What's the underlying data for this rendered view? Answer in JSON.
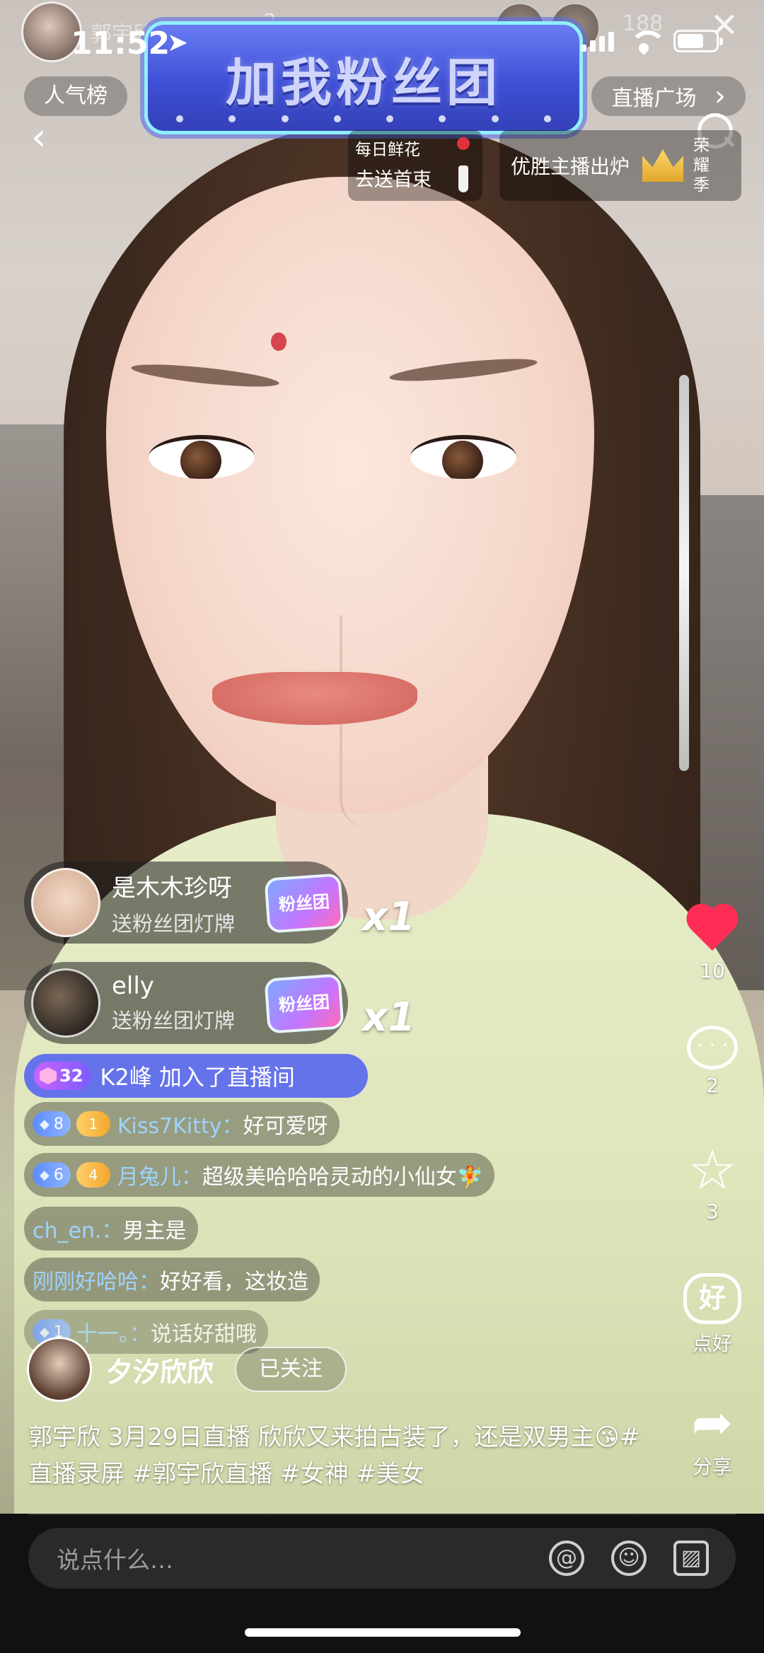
{
  "status_bar": {
    "time": "11:52"
  },
  "top": {
    "streamer_name": "郭宇欣",
    "viewer_count": "188",
    "badge_count": "2",
    "fan_banner": "加我粉丝团",
    "left_tab": "人气榜",
    "right_tab": "直播广场",
    "right_tab_chevron": "›"
  },
  "promos": {
    "flower_line1": "每日鲜花",
    "flower_line2": "去送首束",
    "winner": "优胜主播出炉",
    "season": "荣耀季"
  },
  "gifts": [
    {
      "name": "是木木珍呀",
      "action": "送粉丝团灯牌",
      "badge": "粉丝团",
      "count": "x1"
    },
    {
      "name": "elly",
      "action": "送粉丝团灯牌",
      "badge": "粉丝团",
      "count": "x1"
    }
  ],
  "join": {
    "level": "32",
    "text": "K2峰 加入了直播间"
  },
  "chat": [
    {
      "rank": "8",
      "heart": "1",
      "user": "Kiss7Kitty：",
      "msg": "好可爱呀"
    },
    {
      "rank": "6",
      "heart": "4",
      "user": "月兔儿：",
      "msg": "超级美哈哈哈灵动的小仙女🧚"
    },
    {
      "rank": "",
      "heart": "",
      "user": "ch_en.：",
      "msg": "男主是"
    },
    {
      "rank": "",
      "heart": "",
      "user": "刚刚好哈哈：",
      "msg": "好好看，这妆造"
    },
    {
      "rank": "1",
      "heart": "",
      "user": "十一。：",
      "msg": "说话好甜哦"
    }
  ],
  "rail": {
    "likes": "10",
    "comments": "2",
    "stars": "3",
    "good_label": "点好",
    "good_glyph": "好",
    "share_label": "分享"
  },
  "author": {
    "name": "夕汐欣欣",
    "follow": "已关注"
  },
  "caption": "郭宇欣 3月29日直播 欣欣又来拍古装了，还是双男主😘#直播录屏 #郭宇欣直播 #女神 #美女",
  "input": {
    "placeholder": "说点什么…"
  },
  "icons": [
    "back-icon",
    "search-icon",
    "close-icon",
    "heart-icon",
    "comment-icon",
    "star-icon",
    "share-icon",
    "at-icon",
    "emoji-icon",
    "image-icon"
  ],
  "colors": {
    "like": "#ff2d55",
    "join_bg": "#5866f0",
    "username": "#9ed3ff"
  }
}
